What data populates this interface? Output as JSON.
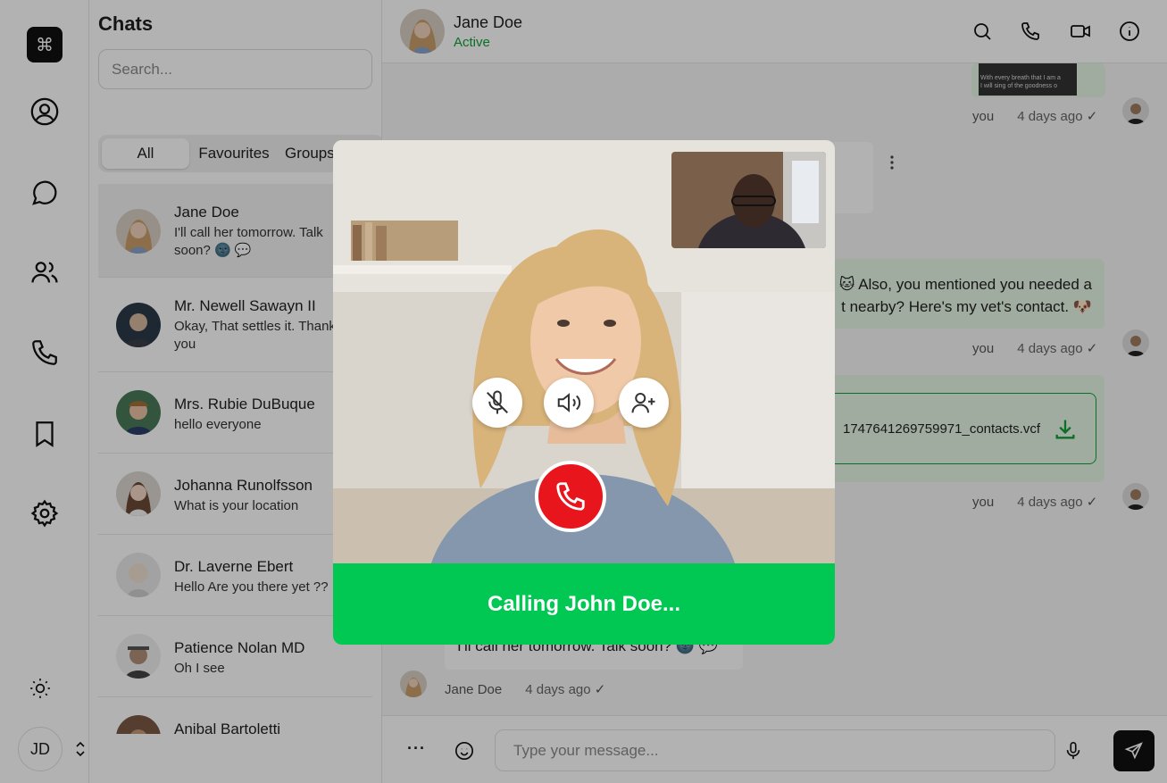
{
  "rail": {
    "logo_glyph": "⌘",
    "user_initials": "JD"
  },
  "chat_list": {
    "title": "Chats",
    "search_placeholder": "Search...",
    "tabs": [
      "All",
      "Favourites",
      "Groups"
    ],
    "conversations": [
      {
        "name": "Jane Doe",
        "preview": "I'll call her tomorrow. Talk soon? 🌚 💬",
        "selected": true
      },
      {
        "name": "Mr. Newell Sawayn II",
        "preview": "Okay, That settles it. Thank you"
      },
      {
        "name": "Mrs. Rubie DuBuque",
        "preview": "hello everyone"
      },
      {
        "name": "Johanna Runolfsson",
        "preview": "What is your location"
      },
      {
        "name": "Dr. Laverne Ebert",
        "preview": "Hello Are you there yet ??"
      },
      {
        "name": "Patience Nolan MD",
        "preview": "Oh I see"
      },
      {
        "name": "Anibal Bartoletti",
        "preview": ""
      }
    ]
  },
  "header": {
    "name": "Jane Doe",
    "status": "Active"
  },
  "messages": {
    "img_caption": "With every breath that I am a\nI will sing of the goodness o",
    "vet_text": "🐱 Also, you mentioned you needed a\nt nearby? Here's my vet's contact. 🐶",
    "file_name": "1747641269759971_contacts.vcf",
    "last_text": "I'll call her tomorrow. Talk soon? 🌚 💬",
    "sender_you": "you",
    "sender_jane": "Jane Doe",
    "time": "4 days ago",
    "check": "✓"
  },
  "composer": {
    "placeholder": "Type your message...",
    "more": "···"
  },
  "call": {
    "status_text": "Calling John Doe..."
  },
  "colors": {
    "active_green": "#12a03a",
    "call_green": "#00c853",
    "hangup_red": "#e8151c",
    "bubble_green": "#e6f6e6"
  }
}
